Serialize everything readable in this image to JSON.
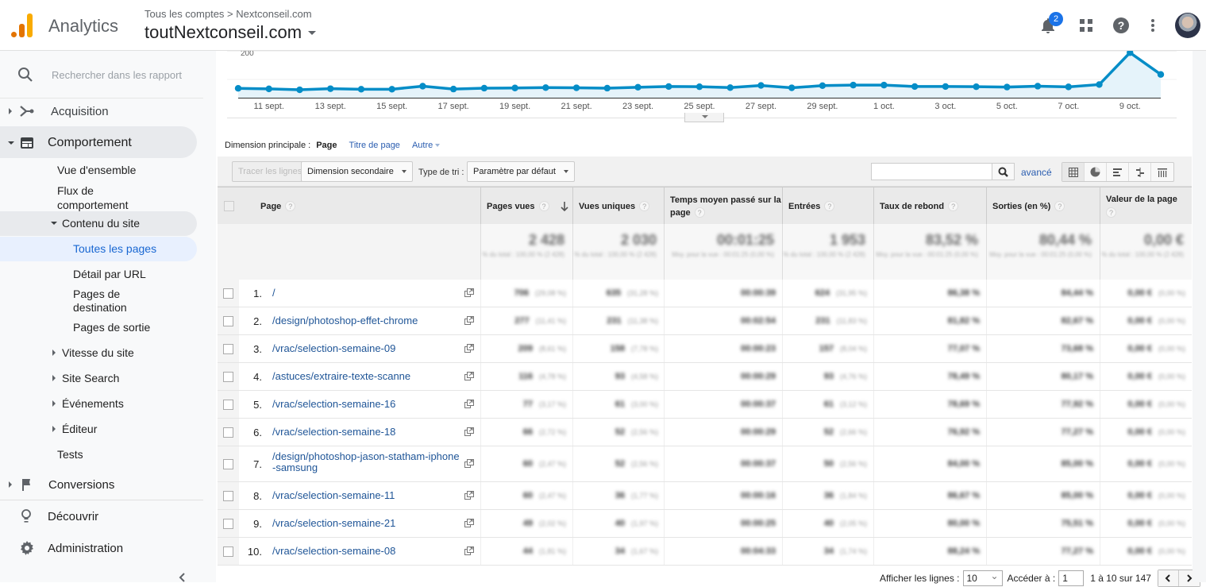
{
  "header": {
    "app_name": "Analytics",
    "breadcrumb": "Tous les comptes > Nextconseil.com",
    "account": "toutNextconseil.com",
    "notification_count": "2"
  },
  "sidebar": {
    "search_placeholder": "Rechercher dans les rapport",
    "items": [
      {
        "label": "Acquisition"
      },
      {
        "label": "Comportement"
      },
      {
        "label": "Vue d'ensemble"
      },
      {
        "label": "Flux de comportement"
      },
      {
        "label": "Contenu du site"
      },
      {
        "label": "Toutes les pages"
      },
      {
        "label": "Détail par URL"
      },
      {
        "label": "Pages de destination"
      },
      {
        "label": "Pages de sortie"
      },
      {
        "label": "Vitesse du site"
      },
      {
        "label": "Site Search"
      },
      {
        "label": "Événements"
      },
      {
        "label": "Éditeur"
      },
      {
        "label": "Tests"
      },
      {
        "label": "Conversions"
      },
      {
        "label": "Découvrir"
      },
      {
        "label": "Administration"
      }
    ],
    "active_item": "Toutes les pages"
  },
  "chart_data": {
    "type": "area",
    "series": [
      {
        "name": "Pages vues",
        "color": "#058dc7"
      }
    ],
    "y_tick_visible": "200",
    "x_tick_labels": [
      "11 sept.",
      "13 sept.",
      "15 sept.",
      "17 sept.",
      "19 sept.",
      "21 sept.",
      "23 sept.",
      "25 sept.",
      "27 sept.",
      "29 sept.",
      "1 oct.",
      "3 oct.",
      "5 oct.",
      "7 oct.",
      "9 oct."
    ],
    "x": [
      "10 sept.",
      "11 sept.",
      "12 sept.",
      "13 sept.",
      "14 sept.",
      "15 sept.",
      "16 sept.",
      "17 sept.",
      "18 sept.",
      "19 sept.",
      "20 sept.",
      "21 sept.",
      "22 sept.",
      "23 sept.",
      "24 sept.",
      "25 sept.",
      "26 sept.",
      "27 sept.",
      "28 sept.",
      "29 sept.",
      "30 sept.",
      "1 oct.",
      "2 oct.",
      "3 oct.",
      "4 oct.",
      "5 oct.",
      "6 oct.",
      "7 oct.",
      "8 oct.",
      "9 oct.",
      "10 oct."
    ],
    "values": [
      52,
      49,
      44,
      50,
      47,
      47,
      64,
      48,
      53,
      54,
      56,
      55,
      53,
      58,
      62,
      61,
      56,
      68,
      55,
      67,
      70,
      70,
      62,
      62,
      61,
      59,
      64,
      60,
      73,
      250,
      129
    ],
    "ylim": [
      0,
      260
    ]
  },
  "dimension": {
    "label": "Dimension principale :",
    "current": "Page",
    "options": [
      "Titre de page",
      "Autre"
    ]
  },
  "toolbar": {
    "plot_rows": "Tracer les lignes",
    "secondary_dimension": "Dimension secondaire",
    "sort_type_label": "Type de tri :",
    "sort_type_value": "Paramètre par défaut",
    "search_value": "",
    "advanced": "avancé"
  },
  "table": {
    "columns": [
      "Page",
      "Pages vues",
      "Vues uniques",
      "Temps moyen passé sur la page",
      "Entrées",
      "Taux de rebond",
      "Sorties (en %)",
      "Valeur de la page"
    ],
    "sorted_column": "Pages vues",
    "summary": {
      "pages_vues": "2 428",
      "vues_uniques": "2 030",
      "temps_moyen": "00:01:25",
      "entrees": "1 953",
      "taux_rebond": "83,52 %",
      "sorties": "80,44 %",
      "valeur": "0,00 €",
      "sub": "% du total : 100,00 % (2 428)",
      "sub_avg": "Moy. pour la vue : 00:01:25 (0,00 %)"
    },
    "rows": [
      {
        "num": "1.",
        "page": "/",
        "pv": "706",
        "pvp": "(29,08 %)",
        "vu": "635",
        "vup": "(31,28 %)",
        "t": "00:00:39",
        "e": "624",
        "ep": "(31,95 %)",
        "r": "86,38 %",
        "s": "84,44 %",
        "val": "0,00 €",
        "valp": "(0,00 %)"
      },
      {
        "num": "2.",
        "page": "/design/photoshop-effet-chrome",
        "pv": "277",
        "pvp": "(11,41 %)",
        "vu": "231",
        "vup": "(11,38 %)",
        "t": "00:02:54",
        "e": "231",
        "ep": "(11,83 %)",
        "r": "81,82 %",
        "s": "82,67 %",
        "val": "0,00 €",
        "valp": "(0,00 %)"
      },
      {
        "num": "3.",
        "page": "/vrac/selection-semaine-09",
        "pv": "209",
        "pvp": "(8,61 %)",
        "vu": "158",
        "vup": "(7,78 %)",
        "t": "00:00:23",
        "e": "157",
        "ep": "(8,04 %)",
        "r": "77,07 %",
        "s": "73,68 %",
        "val": "0,00 €",
        "valp": "(0,00 %)"
      },
      {
        "num": "4.",
        "page": "/astuces/extraire-texte-scanne",
        "pv": "116",
        "pvp": "(4,78 %)",
        "vu": "93",
        "vup": "(4,58 %)",
        "t": "00:00:29",
        "e": "93",
        "ep": "(4,76 %)",
        "r": "78,49 %",
        "s": "80,17 %",
        "val": "0,00 €",
        "valp": "(0,00 %)"
      },
      {
        "num": "5.",
        "page": "/vrac/selection-semaine-16",
        "pv": "77",
        "pvp": "(3,17 %)",
        "vu": "61",
        "vup": "(3,00 %)",
        "t": "00:00:37",
        "e": "61",
        "ep": "(3,12 %)",
        "r": "78,69 %",
        "s": "77,92 %",
        "val": "0,00 €",
        "valp": "(0,00 %)"
      },
      {
        "num": "6.",
        "page": "/vrac/selection-semaine-18",
        "pv": "66",
        "pvp": "(2,72 %)",
        "vu": "52",
        "vup": "(2,56 %)",
        "t": "00:00:29",
        "e": "52",
        "ep": "(2,66 %)",
        "r": "76,92 %",
        "s": "77,27 %",
        "val": "0,00 €",
        "valp": "(0,00 %)"
      },
      {
        "num": "7.",
        "page": "/design/photoshop-jason-statham-iphone-samsung",
        "pv": "60",
        "pvp": "(2,47 %)",
        "vu": "52",
        "vup": "(2,56 %)",
        "t": "00:00:37",
        "e": "50",
        "ep": "(2,56 %)",
        "r": "84,00 %",
        "s": "85,00 %",
        "val": "0,00 €",
        "valp": "(0,00 %)"
      },
      {
        "num": "8.",
        "page": "/vrac/selection-semaine-11",
        "pv": "60",
        "pvp": "(2,47 %)",
        "vu": "36",
        "vup": "(1,77 %)",
        "t": "00:00:16",
        "e": "36",
        "ep": "(1,84 %)",
        "r": "86,67 %",
        "s": "85,00 %",
        "val": "0,00 €",
        "valp": "(0,00 %)"
      },
      {
        "num": "9.",
        "page": "/vrac/selection-semaine-21",
        "pv": "49",
        "pvp": "(2,02 %)",
        "vu": "40",
        "vup": "(1,97 %)",
        "t": "00:00:25",
        "e": "40",
        "ep": "(2,05 %)",
        "r": "80,00 %",
        "s": "75,51 %",
        "val": "0,00 €",
        "valp": "(0,00 %)"
      },
      {
        "num": "10.",
        "page": "/vrac/selection-semaine-08",
        "pv": "44",
        "pvp": "(1,81 %)",
        "vu": "34",
        "vup": "(1,67 %)",
        "t": "00:04:33",
        "e": "34",
        "ep": "(1,74 %)",
        "r": "88,24 %",
        "s": "77,27 %",
        "val": "0,00 €",
        "valp": "(0,00 %)"
      }
    ]
  },
  "pagination": {
    "rows_label": "Afficher les lignes :",
    "rows_value": "10",
    "goto_label": "Accéder à :",
    "goto_value": "1",
    "range": "1 à 10 sur 147"
  }
}
